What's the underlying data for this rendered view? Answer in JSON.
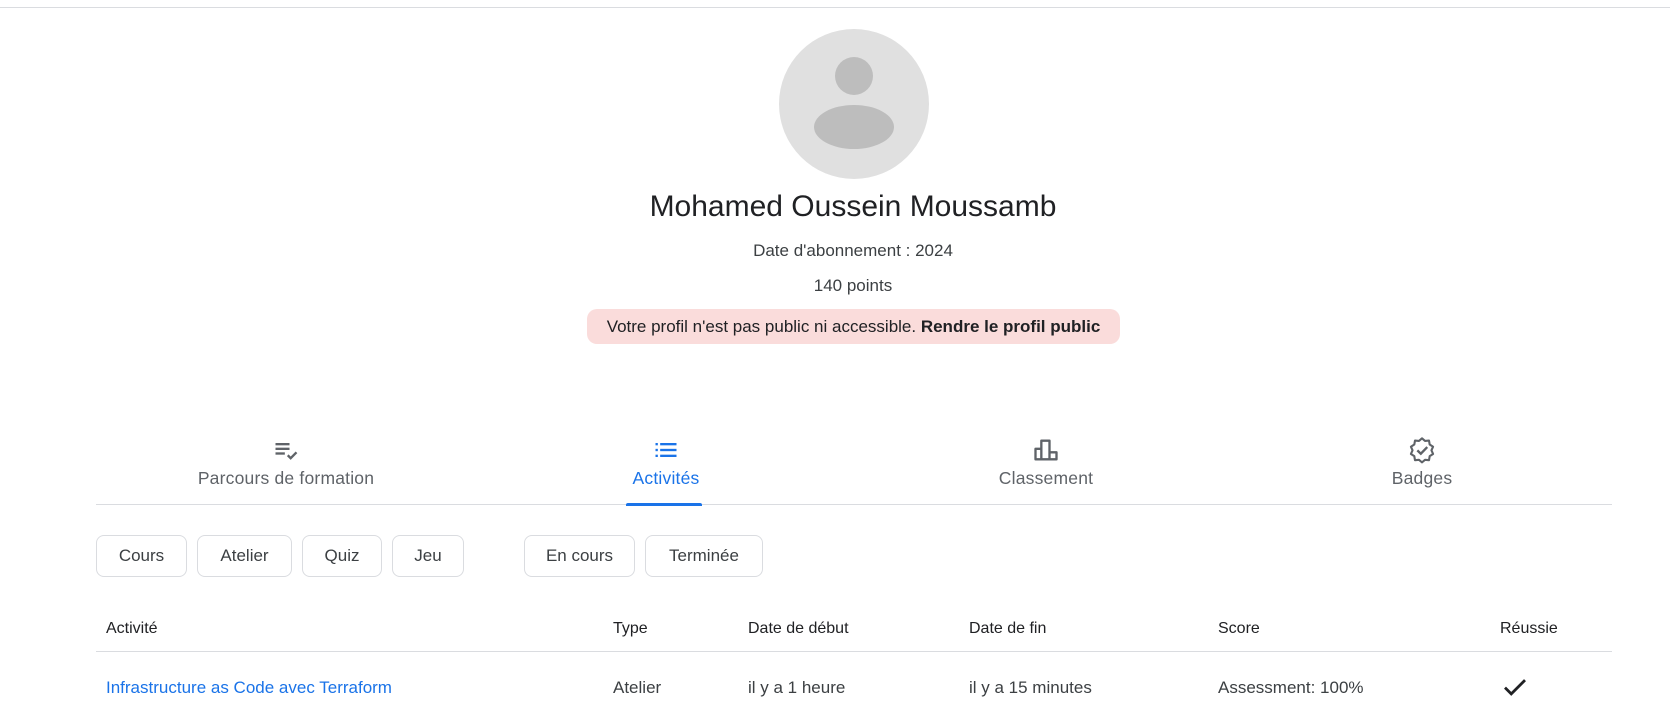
{
  "profile": {
    "name": "Mohamed Oussein Moussamb",
    "member_since": "Date d'abonnement : 2024",
    "points": "140 points",
    "notice_text": "Votre profil n'est pas public ni accessible. ",
    "notice_link": "Rendre le profil public"
  },
  "tabs": [
    {
      "label": "Parcours de formation",
      "icon": "playlist-check-icon",
      "active": false
    },
    {
      "label": "Activités",
      "icon": "list-icon",
      "active": true
    },
    {
      "label": "Classement",
      "icon": "leaderboard-icon",
      "active": false
    },
    {
      "label": "Badges",
      "icon": "verified-badge-icon",
      "active": false
    }
  ],
  "filters": {
    "type_chips": [
      "Cours",
      "Atelier",
      "Quiz",
      "Jeu"
    ],
    "status_chips": [
      "En cours",
      "Terminée"
    ]
  },
  "table": {
    "headers": [
      "Activité",
      "Type",
      "Date de début",
      "Date de fin",
      "Score",
      "Réussie"
    ],
    "rows": [
      {
        "activity": "Infrastructure as Code avec Terraform",
        "type": "Atelier",
        "start": "il y a 1 heure",
        "end": "il y a 15 minutes",
        "score": "Assessment: 100%",
        "passed_icon": "check-icon"
      }
    ]
  },
  "colors": {
    "accent": "#1a73e8",
    "notice_bg": "#fadcdb",
    "muted_text": "#5f6368"
  }
}
